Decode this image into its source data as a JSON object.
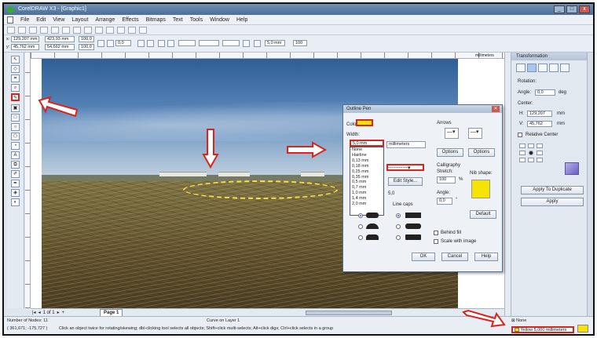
{
  "window": {
    "title": "CorelDRAW X3 - [Graphic1]",
    "controls": [
      "_",
      "□",
      "x"
    ]
  },
  "menu": [
    "File",
    "Edit",
    "View",
    "Layout",
    "Arrange",
    "Effects",
    "Bitmaps",
    "Text",
    "Tools",
    "Window",
    "Help"
  ],
  "propbar": {
    "x": "129,207 mm",
    "y": "45,762 mm",
    "width": "423,93 mm",
    "height": "54,662 mm",
    "scale_x": "100,0",
    "scale_y": "100,0",
    "angle": "0,0",
    "outline_width": "5,0 mm",
    "zoom": "100"
  },
  "ruler_unit": "millimeters",
  "page_nav": {
    "counter": "1 of 1",
    "tab": "Page 1"
  },
  "docker": {
    "title": "Transformation",
    "rotation_label": "Rotation:",
    "angle_label": "Angle:",
    "angle_value": "0,0",
    "angle_unit": "deg",
    "center_label": "Center:",
    "h_value": "129,207",
    "v_value": "45,762",
    "unit": "mm",
    "relative_center_label": "Relative Center",
    "apply_duplicate": "Apply To Duplicate",
    "apply": "Apply"
  },
  "dialog": {
    "title": "Outline Pen",
    "color_label": "Color:",
    "width_label": "Width:",
    "width_value": "5,0 mm",
    "units_value": "millimeters",
    "style_label": "Style:",
    "edit_style": "Edit Style...",
    "arrows_label": "Arrows",
    "options_1": "Options",
    "options_2": "Options",
    "corners_label": "Corners",
    "calligraphy_label": "Calligraphy",
    "stretch_label": "Stretch:",
    "stretch_value": "100",
    "stretch_unit": "%",
    "nib_label": "Nib shape:",
    "angle_label": "Angle:",
    "angle_value": "0,0",
    "angle_unit": "°",
    "line_caps_label": "Line caps",
    "miter_value": "5,0",
    "default_btn": "Default",
    "behind_fill": "Behind fill",
    "scale_with_image": "Scale with image",
    "ok": "OK",
    "cancel": "Cancel",
    "help": "Help",
    "width_options": [
      "None",
      "Hairline",
      "0,13 mm",
      "0,18 mm",
      "0,25 mm",
      "0,35 mm",
      "0,5 mm",
      "0,7 mm",
      "1,0 mm",
      "1,4 mm",
      "2,0 mm"
    ]
  },
  "status": {
    "nodes": "Number of Nodes: 11",
    "curve": "Curve on Layer 1",
    "coords": "( 361,671; -175,727 )",
    "hint": "Click an object twice for rotating/skewing; dbl-clicking tool selects all objects; Shift+click multi-selects; Alt+click digs; Ctrl+click selects in a group",
    "fill_label": "None",
    "outline_label": "Yellow  5,000 millimeters"
  },
  "colors": {
    "accent_red": "#d8251c",
    "yellow": "#f5e400",
    "selection_dash": "#f4e24a"
  }
}
